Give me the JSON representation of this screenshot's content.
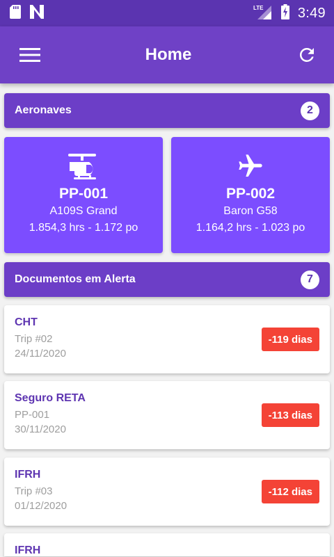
{
  "status_bar": {
    "time": "3:49",
    "icons": [
      "sd-card-icon",
      "n-notification-icon",
      "lte-signal-icon",
      "battery-charging-icon"
    ]
  },
  "app_bar": {
    "title": "Home",
    "menu_icon": "menu-icon",
    "refresh_icon": "refresh-icon"
  },
  "aircraft_section": {
    "title": "Aeronaves",
    "count": "2"
  },
  "aircraft": [
    {
      "icon": "helicopter-icon",
      "registration": "PP-001",
      "model": "A109S Grand",
      "hours": "1.854,3 hrs - 1.172 po"
    },
    {
      "icon": "airplane-icon",
      "registration": "PP-002",
      "model": "Baron G58",
      "hours": "1.164,2 hrs - 1.023 po"
    }
  ],
  "documents_section": {
    "title": "Documentos em Alerta",
    "count": "7"
  },
  "documents": [
    {
      "title": "CHT",
      "subtitle": "Trip #02",
      "date": "24/11/2020",
      "days": "-119 dias"
    },
    {
      "title": "Seguro RETA",
      "subtitle": "PP-001",
      "date": "30/11/2020",
      "days": "-113 dias"
    },
    {
      "title": "IFRH",
      "subtitle": "Trip #03",
      "date": "01/12/2020",
      "days": "-112 dias"
    },
    {
      "title": "IFRH",
      "subtitle": "",
      "date": "",
      "days": ""
    }
  ],
  "colors": {
    "status_bar": "#5b34b0",
    "app_bar": "#6f41c6",
    "section_header": "#6c3ec7",
    "aircraft_card": "#7c4dff",
    "doc_title": "#5e35b1",
    "alert_badge": "#f44336"
  }
}
